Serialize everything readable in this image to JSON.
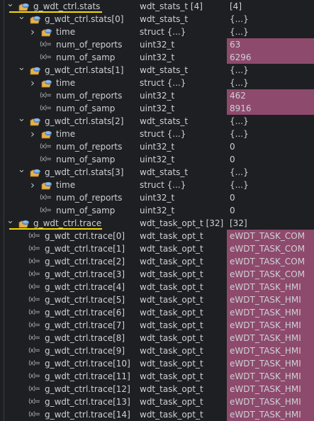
{
  "colors": {
    "changed_bg": "#8e4a6c",
    "underline": "#f5d90a",
    "background": "#1e1f22"
  },
  "rows": [
    {
      "level": 0,
      "kind": "struct",
      "expand": "open",
      "name": "g_wdt_ctrl.stats",
      "type": "wdt_stats_t [4]",
      "value": "[4]",
      "changed": false,
      "underline": true
    },
    {
      "level": 1,
      "kind": "struct",
      "expand": "open",
      "name": "g_wdt_ctrl.stats[0]",
      "type": "wdt_stats_t",
      "value": "{...}",
      "changed": false
    },
    {
      "level": 2,
      "kind": "struct",
      "expand": "closed",
      "name": "time",
      "type": "struct {...}",
      "value": "{...}",
      "changed": false
    },
    {
      "level": 2,
      "kind": "var",
      "name": "num_of_reports",
      "type": "uint32_t",
      "value": "63",
      "changed": true
    },
    {
      "level": 2,
      "kind": "var",
      "name": "num_of_samp",
      "type": "uint32_t",
      "value": "6296",
      "changed": true
    },
    {
      "level": 1,
      "kind": "struct",
      "expand": "open",
      "name": "g_wdt_ctrl.stats[1]",
      "type": "wdt_stats_t",
      "value": "{...}",
      "changed": false
    },
    {
      "level": 2,
      "kind": "struct",
      "expand": "closed",
      "name": "time",
      "type": "struct {...}",
      "value": "{...}",
      "changed": false
    },
    {
      "level": 2,
      "kind": "var",
      "name": "num_of_reports",
      "type": "uint32_t",
      "value": "462",
      "changed": true
    },
    {
      "level": 2,
      "kind": "var",
      "name": "num_of_samp",
      "type": "uint32_t",
      "value": "8916",
      "changed": true
    },
    {
      "level": 1,
      "kind": "struct",
      "expand": "open",
      "name": "g_wdt_ctrl.stats[2]",
      "type": "wdt_stats_t",
      "value": "{...}",
      "changed": false
    },
    {
      "level": 2,
      "kind": "struct",
      "expand": "closed",
      "name": "time",
      "type": "struct {...}",
      "value": "{...}",
      "changed": false
    },
    {
      "level": 2,
      "kind": "var",
      "name": "num_of_reports",
      "type": "uint32_t",
      "value": "0",
      "changed": false
    },
    {
      "level": 2,
      "kind": "var",
      "name": "num_of_samp",
      "type": "uint32_t",
      "value": "0",
      "changed": false
    },
    {
      "level": 1,
      "kind": "struct",
      "expand": "open",
      "name": "g_wdt_ctrl.stats[3]",
      "type": "wdt_stats_t",
      "value": "{...}",
      "changed": false
    },
    {
      "level": 2,
      "kind": "struct",
      "expand": "closed",
      "name": "time",
      "type": "struct {...}",
      "value": "{...}",
      "changed": false
    },
    {
      "level": 2,
      "kind": "var",
      "name": "num_of_reports",
      "type": "uint32_t",
      "value": "0",
      "changed": false
    },
    {
      "level": 2,
      "kind": "var",
      "name": "num_of_samp",
      "type": "uint32_t",
      "value": "0",
      "changed": false
    },
    {
      "level": 0,
      "kind": "struct",
      "expand": "open",
      "name": "g_wdt_ctrl.trace",
      "type": "wdt_task_opt_t [32]",
      "value": "[32]",
      "changed": false,
      "underline": true
    },
    {
      "level": 1,
      "kind": "var",
      "name": "g_wdt_ctrl.trace[0]",
      "type": "wdt_task_opt_t",
      "value": "eWDT_TASK_COM",
      "changed": true
    },
    {
      "level": 1,
      "kind": "var",
      "name": "g_wdt_ctrl.trace[1]",
      "type": "wdt_task_opt_t",
      "value": "eWDT_TASK_COM",
      "changed": true
    },
    {
      "level": 1,
      "kind": "var",
      "name": "g_wdt_ctrl.trace[2]",
      "type": "wdt_task_opt_t",
      "value": "eWDT_TASK_COM",
      "changed": true
    },
    {
      "level": 1,
      "kind": "var",
      "name": "g_wdt_ctrl.trace[3]",
      "type": "wdt_task_opt_t",
      "value": "eWDT_TASK_COM",
      "changed": true
    },
    {
      "level": 1,
      "kind": "var",
      "name": "g_wdt_ctrl.trace[4]",
      "type": "wdt_task_opt_t",
      "value": "eWDT_TASK_HMI",
      "changed": true
    },
    {
      "level": 1,
      "kind": "var",
      "name": "g_wdt_ctrl.trace[5]",
      "type": "wdt_task_opt_t",
      "value": "eWDT_TASK_HMI",
      "changed": true
    },
    {
      "level": 1,
      "kind": "var",
      "name": "g_wdt_ctrl.trace[6]",
      "type": "wdt_task_opt_t",
      "value": "eWDT_TASK_HMI",
      "changed": true
    },
    {
      "level": 1,
      "kind": "var",
      "name": "g_wdt_ctrl.trace[7]",
      "type": "wdt_task_opt_t",
      "value": "eWDT_TASK_HMI",
      "changed": true
    },
    {
      "level": 1,
      "kind": "var",
      "name": "g_wdt_ctrl.trace[8]",
      "type": "wdt_task_opt_t",
      "value": "eWDT_TASK_HMI",
      "changed": true
    },
    {
      "level": 1,
      "kind": "var",
      "name": "g_wdt_ctrl.trace[9]",
      "type": "wdt_task_opt_t",
      "value": "eWDT_TASK_HMI",
      "changed": true
    },
    {
      "level": 1,
      "kind": "var",
      "name": "g_wdt_ctrl.trace[10]",
      "type": "wdt_task_opt_t",
      "value": "eWDT_TASK_HMI",
      "changed": true
    },
    {
      "level": 1,
      "kind": "var",
      "name": "g_wdt_ctrl.trace[11]",
      "type": "wdt_task_opt_t",
      "value": "eWDT_TASK_HMI",
      "changed": true
    },
    {
      "level": 1,
      "kind": "var",
      "name": "g_wdt_ctrl.trace[12]",
      "type": "wdt_task_opt_t",
      "value": "eWDT_TASK_HMI",
      "changed": true
    },
    {
      "level": 1,
      "kind": "var",
      "name": "g_wdt_ctrl.trace[13]",
      "type": "wdt_task_opt_t",
      "value": "eWDT_TASK_HMI",
      "changed": true
    },
    {
      "level": 1,
      "kind": "var",
      "name": "g_wdt_ctrl.trace[14]",
      "type": "wdt_task_opt_t",
      "value": "eWDT_TASK_HMI",
      "changed": true
    }
  ]
}
